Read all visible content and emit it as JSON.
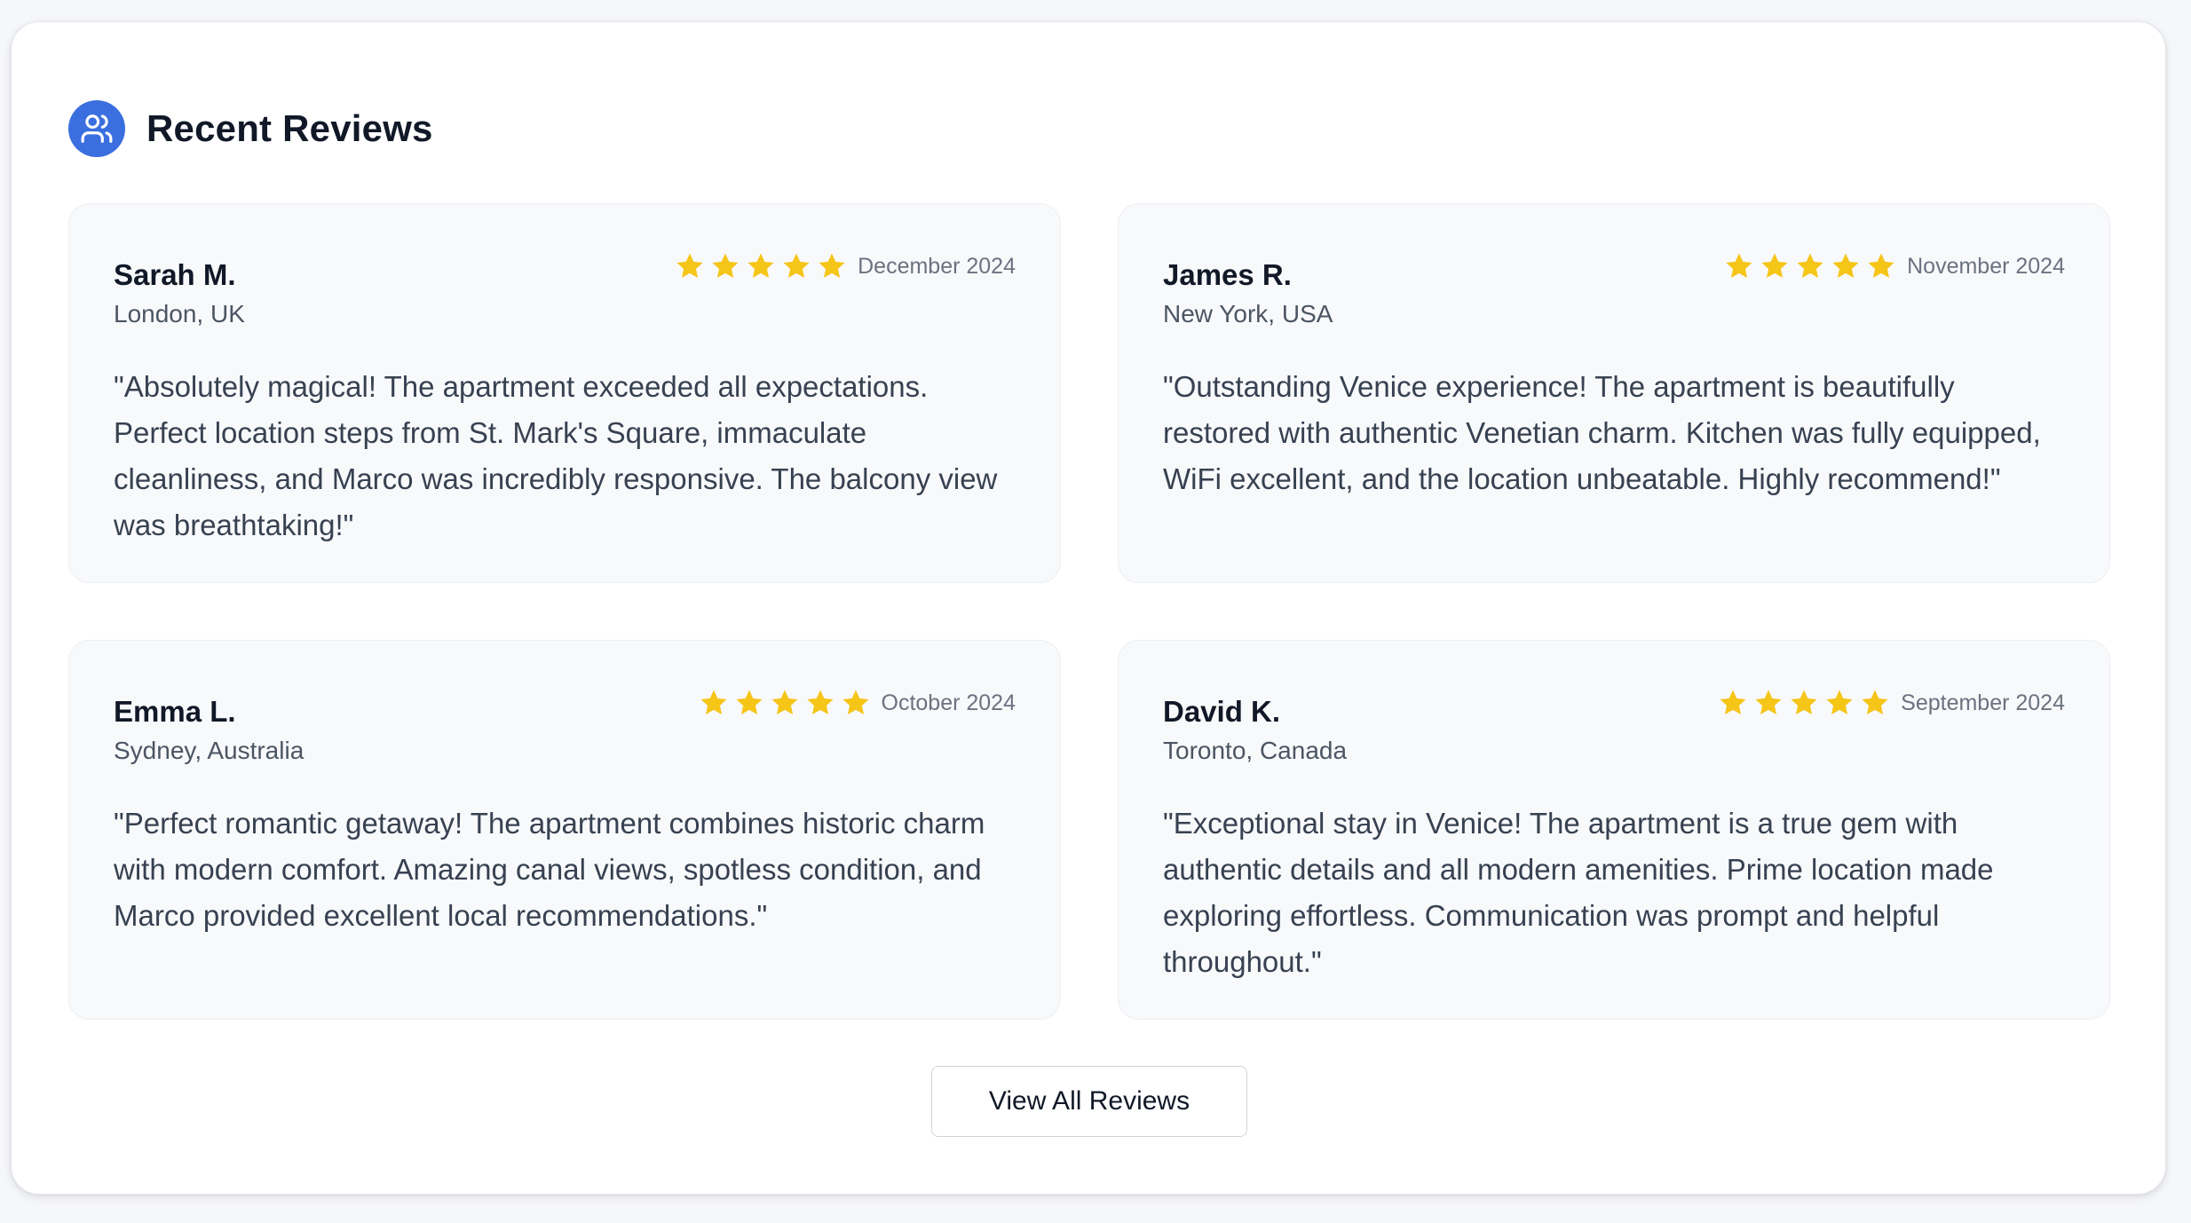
{
  "section": {
    "title": "Recent Reviews",
    "icon": "users-icon",
    "accent_color": "#3b6fe0"
  },
  "rating": {
    "star_color": "#f5c518",
    "max_stars": 5
  },
  "reviews": [
    {
      "name": "Sarah M.",
      "location": "London, UK",
      "date": "December 2024",
      "stars": 5,
      "text": "\"Absolutely magical! The apartment exceeded all expectations. Perfect location steps from St. Mark's Square, immaculate cleanliness, and Marco was incredibly responsive. The balcony view was breathtaking!\""
    },
    {
      "name": "James R.",
      "location": "New York, USA",
      "date": "November 2024",
      "stars": 5,
      "text": "\"Outstanding Venice experience! The apartment is beautifully restored with authentic Venetian charm. Kitchen was fully equipped, WiFi excellent, and the location unbeatable. Highly recommend!\""
    },
    {
      "name": "Emma L.",
      "location": "Sydney, Australia",
      "date": "October 2024",
      "stars": 5,
      "text": "\"Perfect romantic getaway! The apartment combines historic charm with modern comfort. Amazing canal views, spotless condition, and Marco provided excellent local recommendations.\""
    },
    {
      "name": "David K.",
      "location": "Toronto, Canada",
      "date": "September 2024",
      "stars": 5,
      "text": "\"Exceptional stay in Venice! The apartment is a true gem with authentic details and all modern amenities. Prime location made exploring effortless. Communication was prompt and helpful throughout.\""
    }
  ],
  "actions": {
    "view_all_label": "View All Reviews"
  }
}
